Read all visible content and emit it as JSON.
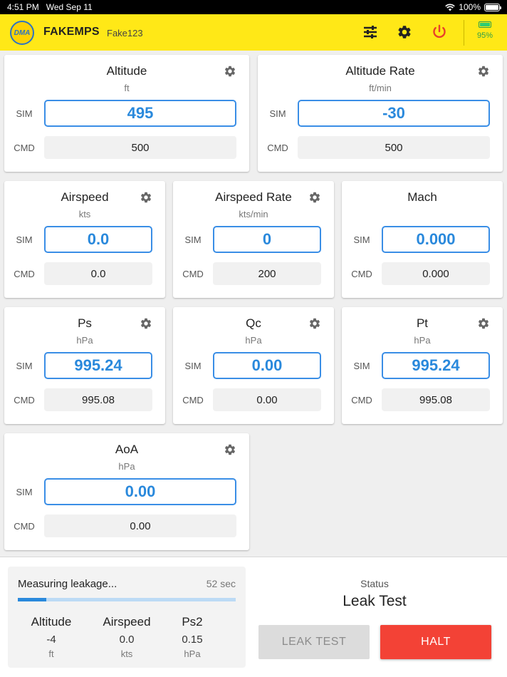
{
  "status_bar": {
    "time": "4:51 PM",
    "date": "Wed Sep 11",
    "battery": "100%"
  },
  "header": {
    "logo_text": "DMA",
    "app_name": "FAKEMPS",
    "device_id": "Fake123",
    "battery_percent": "95%",
    "power_icon_color": "#e8402a",
    "accent_color": "#ffe817"
  },
  "labels": {
    "sim": "SIM",
    "cmd": "CMD"
  },
  "cards": {
    "altitude": {
      "title": "Altitude",
      "unit": "ft",
      "sim": "495",
      "cmd": "500"
    },
    "altitude_rate": {
      "title": "Altitude Rate",
      "unit": "ft/min",
      "sim": "-30",
      "cmd": "500"
    },
    "airspeed": {
      "title": "Airspeed",
      "unit": "kts",
      "sim": "0.0",
      "cmd": "0.0"
    },
    "airspeed_rate": {
      "title": "Airspeed Rate",
      "unit": "kts/min",
      "sim": "0",
      "cmd": "200"
    },
    "mach": {
      "title": "Mach",
      "unit": "",
      "sim": "0.000",
      "cmd": "0.000"
    },
    "ps": {
      "title": "Ps",
      "unit": "hPa",
      "sim": "995.24",
      "cmd": "995.08"
    },
    "qc": {
      "title": "Qc",
      "unit": "hPa",
      "sim": "0.00",
      "cmd": "0.00"
    },
    "pt": {
      "title": "Pt",
      "unit": "hPa",
      "sim": "995.24",
      "cmd": "995.08"
    },
    "aoa": {
      "title": "AoA",
      "unit": "hPa",
      "sim": "0.00",
      "cmd": "0.00"
    }
  },
  "leak": {
    "message": "Measuring leakage...",
    "seconds": "52 sec",
    "progress": 0.13,
    "columns": [
      {
        "name": "Altitude",
        "value": "-4",
        "unit": "ft"
      },
      {
        "name": "Airspeed",
        "value": "0.0",
        "unit": "kts"
      },
      {
        "name": "Ps2",
        "value": "0.15",
        "unit": "hPa"
      }
    ]
  },
  "status": {
    "label": "Status",
    "value": "Leak Test"
  },
  "buttons": {
    "leak_test": "LEAK TEST",
    "halt": "HALT"
  }
}
